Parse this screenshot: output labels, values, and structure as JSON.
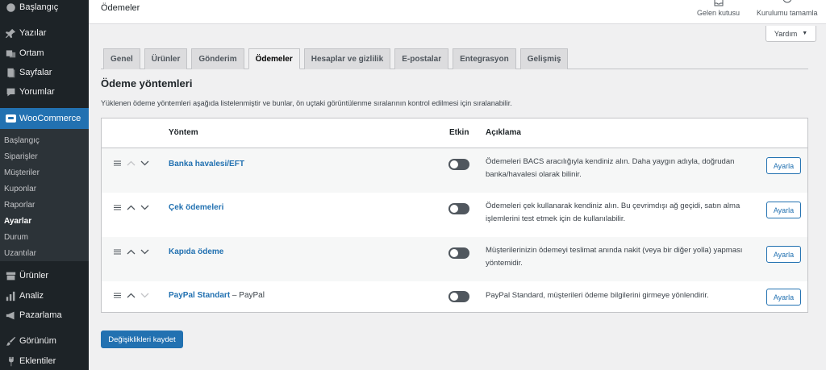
{
  "sidebar": {
    "dashboard": "Başlangıç",
    "posts": "Yazılar",
    "media": "Ortam",
    "pages": "Sayfalar",
    "comments": "Yorumlar",
    "woocommerce": "WooCommerce",
    "submenu": [
      "Başlangıç",
      "Siparişler",
      "Müşteriler",
      "Kuponlar",
      "Raporlar",
      "Ayarlar",
      "Durum",
      "Uzantılar"
    ],
    "products": "Ürünler",
    "analytics": "Analiz",
    "marketing": "Pazarlama",
    "appearance": "Görünüm",
    "plugins": "Eklentiler"
  },
  "header": {
    "title": "Ödemeler",
    "inbox": "Gelen kutusu",
    "setup": "Kurulumu tamamla",
    "help": "Yardım"
  },
  "tabs": [
    "Genel",
    "Ürünler",
    "Gönderim",
    "Ödemeler",
    "Hesaplar ve gizlilik",
    "E-postalar",
    "Entegrasyon",
    "Gelişmiş"
  ],
  "section": {
    "title": "Ödeme yöntemleri",
    "description": "Yüklenen ödeme yöntemleri aşağıda listelenmiştir ve bunlar, ön uçtaki görüntülenme sıralarının kontrol edilmesi için sıralanabilir."
  },
  "table": {
    "headers": {
      "method": "Yöntem",
      "enabled": "Etkin",
      "description": "Açıklama"
    },
    "rows": [
      {
        "name": "Banka havalesi/EFT",
        "extra": "",
        "desc": "Ödemeleri BACS aracılığıyla kendiniz alın. Daha yaygın adıyla, doğrudan banka/havalesi olarak bilinir.",
        "button": "Ayarla"
      },
      {
        "name": "Çek ödemeleri",
        "extra": "",
        "desc": "Ödemeleri çek kullanarak kendiniz alın. Bu çevrimdışı ağ geçidi, satın alma işlemlerini test etmek için de kullanılabilir.",
        "button": "Ayarla"
      },
      {
        "name": "Kapıda ödeme",
        "extra": "",
        "desc": "Müşterilerinizin ödemeyi teslimat anında nakit (veya bir diğer yolla) yapması yöntemidir.",
        "button": "Ayarla"
      },
      {
        "name": "PayPal Standart",
        "extra": " – PayPal",
        "desc": "PayPal Standard, müşterileri ödeme bilgilerini girmeye yönlendirir.",
        "button": "Ayarla"
      }
    ]
  },
  "save_label": "Değişiklikleri kaydet",
  "colors": {
    "accent": "#2271b1",
    "sidebar": "#1d2327",
    "submenu": "#2c3338"
  }
}
